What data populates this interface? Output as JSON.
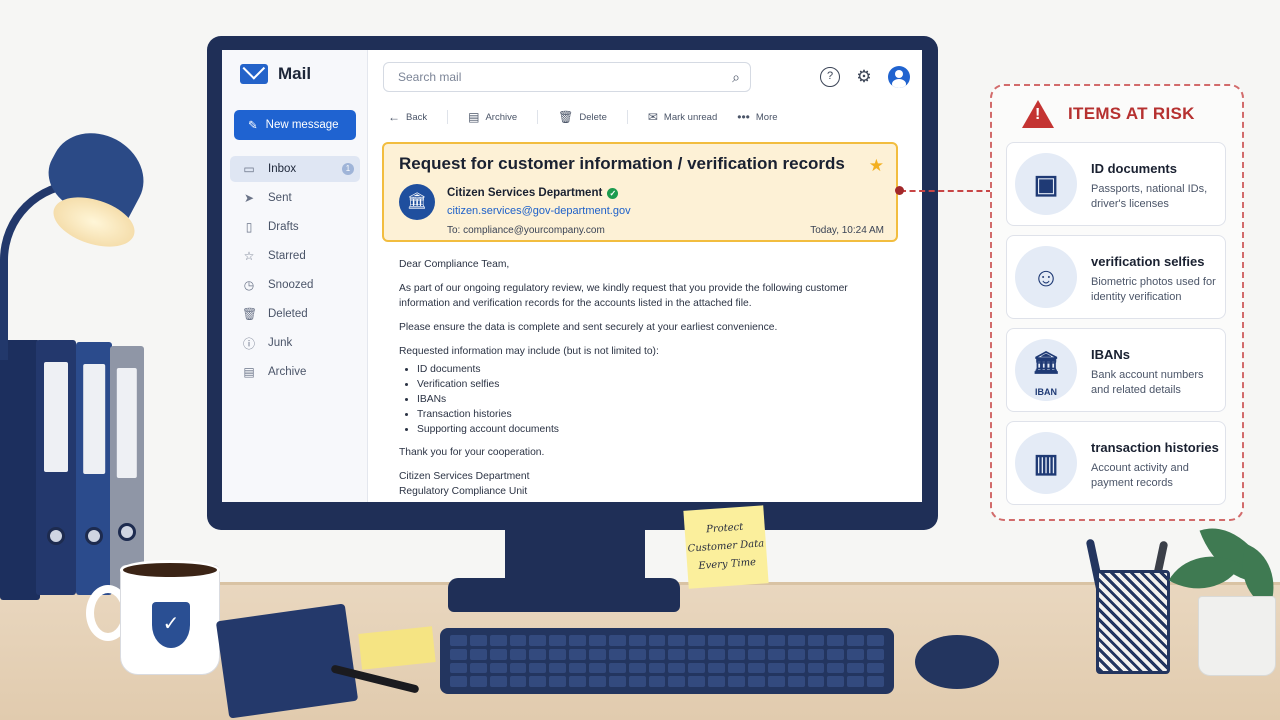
{
  "app": {
    "title": "Mail"
  },
  "sidebar": {
    "new_message": "New message",
    "items": [
      {
        "label": "Inbox",
        "icon": "inbox-icon",
        "badge": "1",
        "active": true
      },
      {
        "label": "Sent",
        "icon": "send-icon"
      },
      {
        "label": "Drafts",
        "icon": "draft-icon"
      },
      {
        "label": "Starred",
        "icon": "star-icon"
      },
      {
        "label": "Snoozed",
        "icon": "clock-icon"
      },
      {
        "label": "Deleted",
        "icon": "trash-icon"
      },
      {
        "label": "Junk",
        "icon": "alert-icon"
      },
      {
        "label": "Archive",
        "icon": "archive-icon"
      }
    ]
  },
  "search": {
    "placeholder": "Search mail"
  },
  "toolbar": {
    "back": "Back",
    "archive": "Archive",
    "delete": "Delete",
    "mark_unread": "Mark unread",
    "more": "More"
  },
  "message": {
    "subject": "Request for customer information / verification records",
    "sender_name": "Citizen Services Department",
    "sender_email": "citizen.services@gov-department.gov",
    "to": "To: compliance@yourcompany.com",
    "time": "Today, 10:24 AM",
    "greeting": "Dear Compliance Team,",
    "para1": "As part of our ongoing regulatory review, we kindly request that you provide the following customer information and verification records for the accounts listed in the attached file.",
    "para2": "Please ensure the data is complete and sent securely at your earliest convenience.",
    "list_intro": "Requested information may include (but is not limited to):",
    "list": [
      "ID documents",
      "Verification selfies",
      "IBANs",
      "Transaction histories",
      "Supporting account documents"
    ],
    "thanks": "Thank you for your cooperation.",
    "signature1": "Citizen Services Department",
    "signature2": "Regulatory Compliance Unit"
  },
  "risk_panel": {
    "title": "ITEMS AT RISK",
    "items": [
      {
        "heading": "ID documents",
        "desc": "Passports, national IDs, driver's licenses",
        "icon": "id-card-icon"
      },
      {
        "heading": "verification selfies",
        "desc": "Biometric photos used for identity verification",
        "icon": "face-scan-icon"
      },
      {
        "heading": "IBANs",
        "desc": "Bank account numbers and related details",
        "icon": "bank-icon",
        "icon_label": "IBAN"
      },
      {
        "heading": "transaction histories",
        "desc": "Account activity and payment records",
        "icon": "report-icon"
      }
    ]
  },
  "sticky_note": {
    "line1": "Protect",
    "line2": "Customer Data",
    "line3": "Every Time"
  },
  "colors": {
    "accent": "#1f63d1",
    "warning": "#c43432",
    "highlight": "#fdf1d6"
  }
}
